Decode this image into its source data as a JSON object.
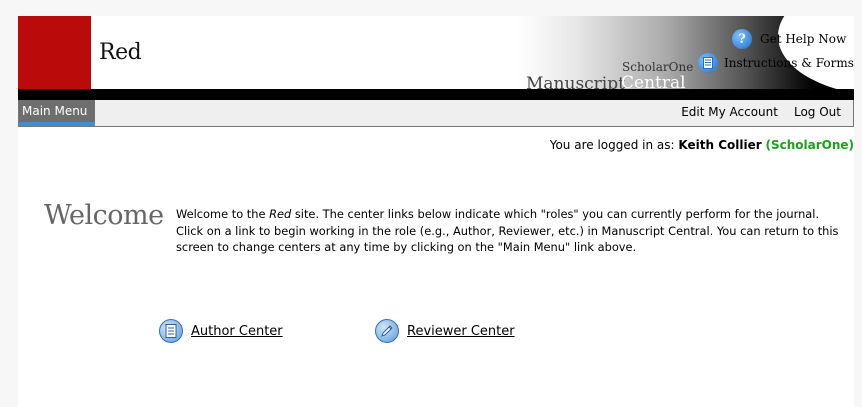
{
  "banner": {
    "journal_name": "Red",
    "brand_small": "ScholarOne",
    "brand_word1": "Manuscript",
    "brand_word2": "Central",
    "help_label": "Get Help Now",
    "instructions_label": "Instructions & Forms"
  },
  "menu": {
    "main_menu": "Main Menu",
    "edit_account": "Edit My Account",
    "log_out": "Log Out"
  },
  "session": {
    "prefix": "You are logged in as: ",
    "user": "Keith Collier",
    "org": "(ScholarOne)"
  },
  "welcome": {
    "heading": "Welcome",
    "text_part1": "Welcome to the ",
    "journal_italic": "Red",
    "text_part2": " site. The center links below indicate which \"roles\" you can currently perform for the journal. Click on a link to begin working in the role (e.g., Author, Reviewer, etc.) in Manuscript Central. You can return to this screen to change centers at any time by clicking on the \"Main Menu\" link above."
  },
  "centers": {
    "author": "Author Center",
    "reviewer": "Reviewer Center"
  },
  "icons": {
    "help": "help-icon",
    "instructions": "document-icon",
    "author": "document-icon",
    "reviewer": "pencil-icon"
  },
  "colors": {
    "brand_red": "#bb0a0a",
    "menu_accent": "#3d8fd6",
    "org_green": "#18a318"
  }
}
